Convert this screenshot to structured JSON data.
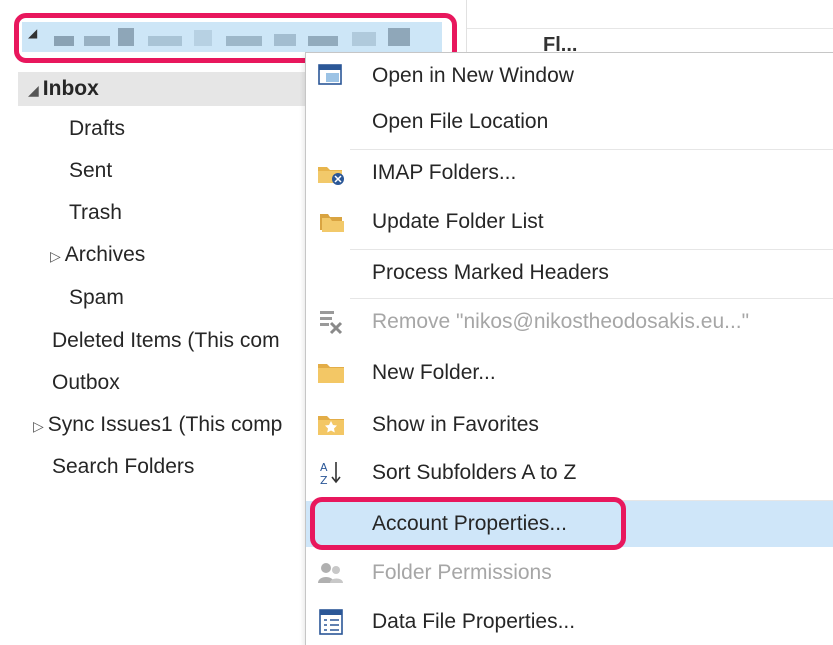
{
  "folders": {
    "inbox": "Inbox",
    "items": [
      {
        "label": "Drafts"
      },
      {
        "label": "Sent"
      },
      {
        "label": "Trash"
      },
      {
        "label": "Archives"
      },
      {
        "label": "Spam"
      },
      {
        "label": "Deleted Items (This com"
      },
      {
        "label": "Outbox"
      },
      {
        "label": "Sync Issues1 (This comp"
      },
      {
        "label": "Search Folders"
      }
    ]
  },
  "behind_heading": "Fl...",
  "context_menu": {
    "items": [
      {
        "label": "Open in New Window",
        "icon": "open-window-icon"
      },
      {
        "label": "Open File Location",
        "icon": ""
      },
      {
        "label": "IMAP Folders...",
        "icon": "imap-folders-icon"
      },
      {
        "label": "Update Folder List",
        "icon": "update-folder-list-icon"
      },
      {
        "label": "Process Marked Headers",
        "icon": ""
      },
      {
        "label": "Remove \"nikos@nikostheodosakis.eu...\"",
        "icon": "remove-account-icon",
        "disabled": true
      },
      {
        "label": "New Folder...",
        "icon": "new-folder-icon"
      },
      {
        "label": "Show in Favorites",
        "icon": "favorites-icon"
      },
      {
        "label": "Sort Subfolders A to Z",
        "icon": "sort-az-icon"
      },
      {
        "label": "Account Properties...",
        "icon": "",
        "selected": true
      },
      {
        "label": "Folder Permissions",
        "icon": "folder-permissions-icon",
        "disabled": true
      },
      {
        "label": "Data File Properties...",
        "icon": "data-file-properties-icon"
      }
    ]
  },
  "colors": {
    "selection": "#cfe6f9",
    "highlight_annotation": "#e8175d",
    "account_row": "#cde6f7"
  }
}
